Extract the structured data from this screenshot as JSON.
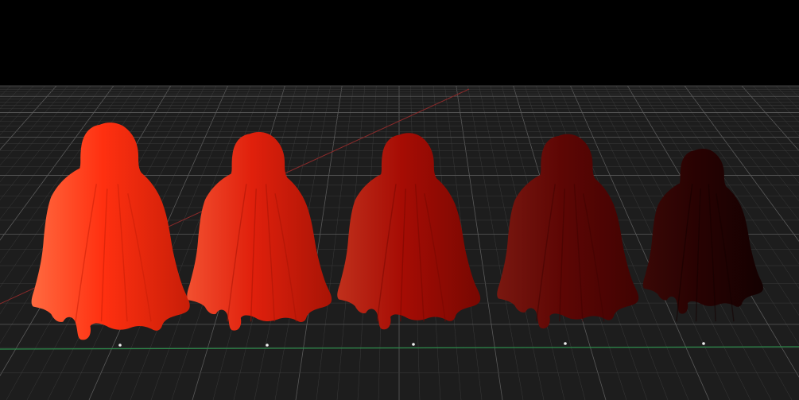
{
  "viewport": {
    "background_color": "#000000",
    "floor_color": "#1d1d1d",
    "grid_minor_color": "#3a3a3a",
    "grid_major_color": "#5a5a5a",
    "x_axis_color": "#2c8a4a",
    "z_axis_color": "#8a2a2a"
  },
  "figures": [
    {
      "name": "cloaked-figure-1",
      "body_color": "#ff3010",
      "shadow_color": "#c81e08",
      "highlight_color": "#ff6a40"
    },
    {
      "name": "cloaked-figure-2",
      "body_color": "#e0200c",
      "shadow_color": "#a81406",
      "highlight_color": "#f25030"
    },
    {
      "name": "cloaked-figure-3",
      "body_color": "#a60c04",
      "shadow_color": "#780802",
      "highlight_color": "#c0301c"
    },
    {
      "name": "cloaked-figure-4",
      "body_color": "#5e0604",
      "shadow_color": "#400302",
      "highlight_color": "#7a1810"
    },
    {
      "name": "cloaked-figure-5",
      "body_color": "#280202",
      "shadow_color": "#140101",
      "highlight_color": "#3a0806"
    }
  ],
  "pivot_markers": [
    {
      "name": "pivot-marker-1"
    },
    {
      "name": "pivot-marker-2"
    },
    {
      "name": "pivot-marker-3"
    },
    {
      "name": "pivot-marker-4"
    },
    {
      "name": "pivot-marker-5"
    }
  ]
}
